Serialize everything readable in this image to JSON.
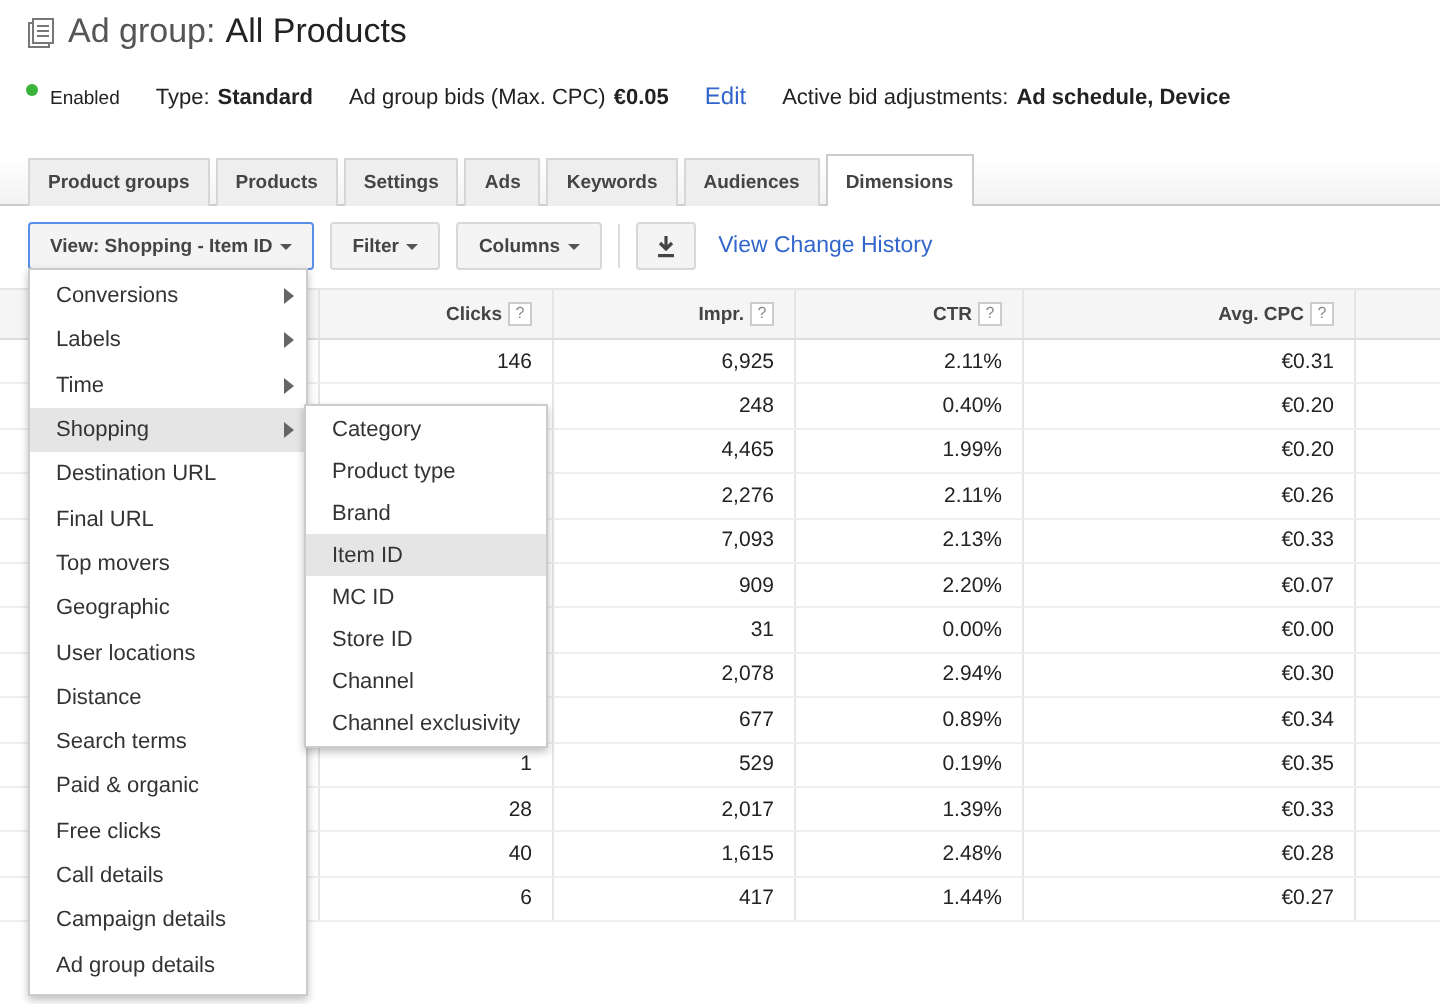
{
  "header": {
    "title_prefix": "Ad group:",
    "title": "All Products"
  },
  "summary": {
    "status": "Enabled",
    "type_label": "Type:",
    "type_value": "Standard",
    "bids_label": "Ad group bids (Max. CPC)",
    "bids_value": "€0.05",
    "edit_link": "Edit",
    "adjustments_label": "Active bid adjustments:",
    "adjustments_value": "Ad schedule, Device"
  },
  "tabs": [
    {
      "label": "Product groups",
      "selected": false
    },
    {
      "label": "Products",
      "selected": false
    },
    {
      "label": "Settings",
      "selected": false
    },
    {
      "label": "Ads",
      "selected": false
    },
    {
      "label": "Keywords",
      "selected": false
    },
    {
      "label": "Audiences",
      "selected": false
    },
    {
      "label": "Dimensions",
      "selected": true
    }
  ],
  "toolbar": {
    "view_button": "View: Shopping - Item ID",
    "filter_button": "Filter",
    "columns_button": "Columns",
    "history_link": "View Change History"
  },
  "table": {
    "columns": [
      {
        "label": "Clicks",
        "help": "?"
      },
      {
        "label": "Impr.",
        "help": "?"
      },
      {
        "label": "CTR",
        "help": "?"
      },
      {
        "label": "Avg. CPC",
        "help": "?"
      }
    ],
    "rows": [
      {
        "clicks": "146",
        "impr": "6,925",
        "ctr": "2.11%",
        "cpc": "€0.31"
      },
      {
        "impr": "248",
        "ctr": "0.40%",
        "cpc": "€0.20"
      },
      {
        "impr": "4,465",
        "ctr": "1.99%",
        "cpc": "€0.20"
      },
      {
        "impr": "2,276",
        "ctr": "2.11%",
        "cpc": "€0.26"
      },
      {
        "impr": "7,093",
        "ctr": "2.13%",
        "cpc": "€0.33"
      },
      {
        "impr": "909",
        "ctr": "2.20%",
        "cpc": "€0.07"
      },
      {
        "impr": "31",
        "ctr": "0.00%",
        "cpc": "€0.00"
      },
      {
        "impr": "2,078",
        "ctr": "2.94%",
        "cpc": "€0.30"
      },
      {
        "impr": "677",
        "ctr": "0.89%",
        "cpc": "€0.34"
      },
      {
        "clicks": "1",
        "impr": "529",
        "ctr": "0.19%",
        "cpc": "€0.35"
      },
      {
        "clicks": "28",
        "impr": "2,017",
        "ctr": "1.39%",
        "cpc": "€0.33"
      },
      {
        "clicks": "40",
        "impr": "1,615",
        "ctr": "2.48%",
        "cpc": "€0.28"
      },
      {
        "clicks": "6",
        "impr": "417",
        "ctr": "1.44%",
        "cpc": "€0.27"
      }
    ]
  },
  "view_menu": {
    "items": [
      {
        "label": "Conversions",
        "submenu": true,
        "selected": false
      },
      {
        "label": "Labels",
        "submenu": true,
        "selected": false
      },
      {
        "label": "Time",
        "submenu": true,
        "selected": false
      },
      {
        "label": "Shopping",
        "submenu": true,
        "selected": true
      },
      {
        "label": "Destination URL",
        "submenu": false,
        "selected": false
      },
      {
        "label": "Final URL",
        "submenu": false,
        "selected": false
      },
      {
        "label": "Top movers",
        "submenu": false,
        "selected": false
      },
      {
        "label": "Geographic",
        "submenu": false,
        "selected": false
      },
      {
        "label": "User locations",
        "submenu": false,
        "selected": false
      },
      {
        "label": "Distance",
        "submenu": false,
        "selected": false
      },
      {
        "label": "Search terms",
        "submenu": false,
        "selected": false
      },
      {
        "label": "Paid & organic",
        "submenu": false,
        "selected": false
      },
      {
        "label": "Free clicks",
        "submenu": false,
        "selected": false
      },
      {
        "label": "Call details",
        "submenu": false,
        "selected": false
      },
      {
        "label": "Campaign details",
        "submenu": false,
        "selected": false
      },
      {
        "label": "Ad group details",
        "submenu": false,
        "selected": false
      }
    ]
  },
  "submenu": {
    "items": [
      {
        "label": "Category",
        "selected": false
      },
      {
        "label": "Product type",
        "selected": false
      },
      {
        "label": "Brand",
        "selected": false
      },
      {
        "label": "Item ID",
        "selected": true
      },
      {
        "label": "MC ID",
        "selected": false
      },
      {
        "label": "Store ID",
        "selected": false
      },
      {
        "label": "Channel",
        "selected": false
      },
      {
        "label": "Channel exclusivity",
        "selected": false
      }
    ]
  }
}
